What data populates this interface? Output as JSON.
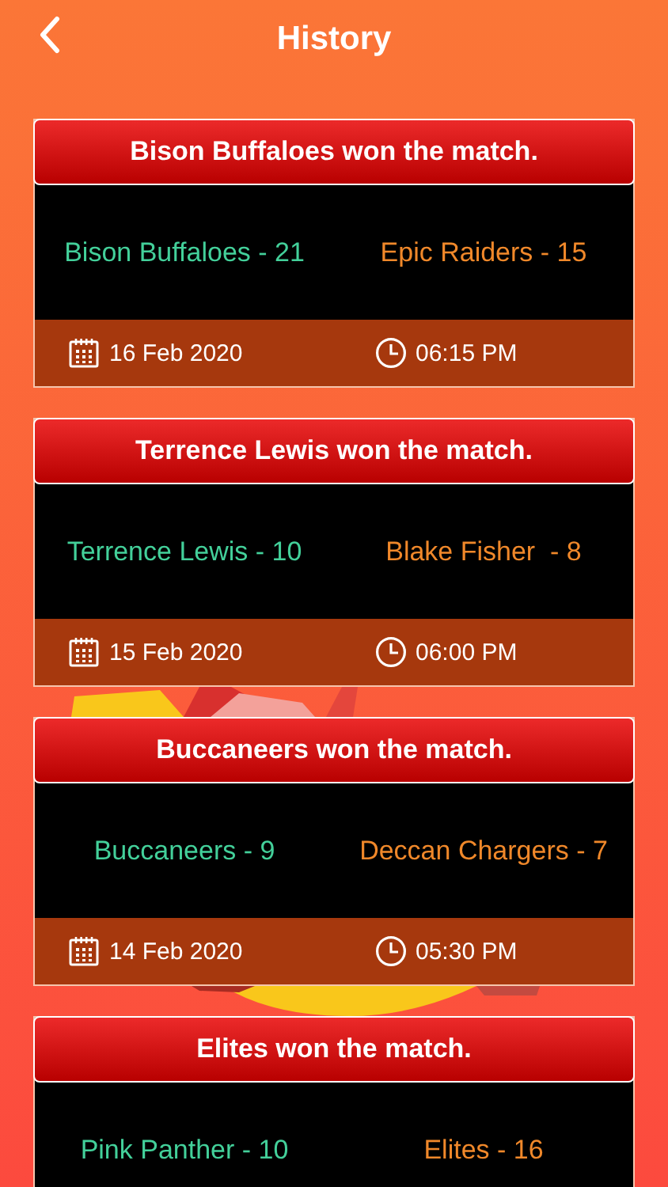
{
  "title": "History",
  "matches": [
    {
      "result": "Bison Buffaloes won the match.",
      "team_a": "Bison Buffaloes - 21",
      "team_b": "Epic Raiders - 15",
      "date": "16 Feb 2020",
      "time": "06:15 PM"
    },
    {
      "result": "Terrence Lewis won the match.",
      "team_a": "Terrence Lewis - 10",
      "team_b": "Blake Fisher  - 8",
      "date": "15 Feb 2020",
      "time": "06:00 PM"
    },
    {
      "result": "Buccaneers won the match.",
      "team_a": "Buccaneers - 9",
      "team_b": "Deccan Chargers - 7",
      "date": "14 Feb 2020",
      "time": "05:30 PM"
    },
    {
      "result": "Elites won the match.",
      "team_a": "Pink Panther - 10",
      "team_b": "Elites - 16"
    }
  ]
}
